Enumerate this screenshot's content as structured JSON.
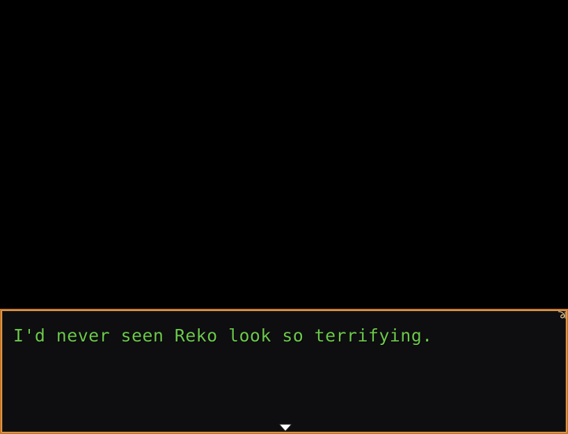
{
  "message": {
    "text": "I'd never seen Reko look so terrifying."
  },
  "colors": {
    "background": "#000000",
    "window_fill": "#0e0e10",
    "window_border": "#c8782c",
    "text": "#6cc84c",
    "arrow": "#ffffff"
  },
  "icons": {
    "corner": "ornament-icon",
    "continue": "continue-arrow-icon"
  }
}
